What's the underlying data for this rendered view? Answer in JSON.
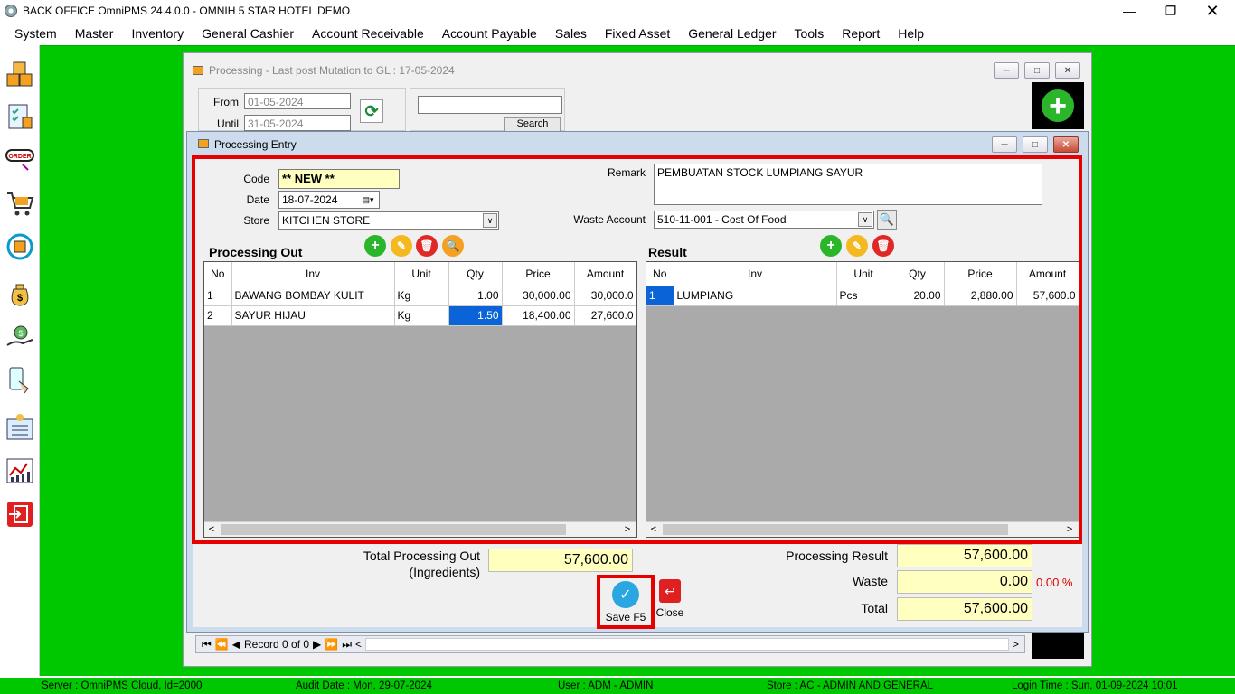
{
  "window": {
    "title": "BACK OFFICE OmniPMS 24.4.0.0 - OMNIH 5 STAR HOTEL DEMO"
  },
  "menu": [
    "System",
    "Master",
    "Inventory",
    "General Cashier",
    "Account Receivable",
    "Account Payable",
    "Sales",
    "Fixed Asset",
    "General Ledger",
    "Tools",
    "Report",
    "Help"
  ],
  "background_window": {
    "title": "Processing - Last post Mutation to GL : 17-05-2024",
    "from_label": "From",
    "from_value": "01-05-2024",
    "until_label": "Until",
    "until_value": "31-05-2024",
    "search_label": "Search",
    "search_value": "",
    "record_text": "Record 0 of 0"
  },
  "dialog": {
    "title": "Processing Entry",
    "code_label": "Code",
    "code_value": "** NEW **",
    "date_label": "Date",
    "date_value": "18-07-2024",
    "store_label": "Store",
    "store_value": "KITCHEN STORE",
    "remark_label": "Remark",
    "remark_value": "PEMBUATAN STOCK LUMPIANG SAYUR",
    "waste_account_label": "Waste Account",
    "waste_account_value": "510-11-001 - Cost Of Food",
    "processing_out": {
      "title": "Processing Out",
      "columns": [
        "No",
        "Inv",
        "Unit",
        "Qty",
        "Price",
        "Amount"
      ],
      "rows": [
        [
          "1",
          "BAWANG BOMBAY KULIT",
          "Kg",
          "1.00",
          "30,000.00",
          "30,000.0"
        ],
        [
          "2",
          "SAYUR HIJAU",
          "Kg",
          "1.50",
          "18,400.00",
          "27,600.0"
        ]
      ]
    },
    "result": {
      "title": "Result",
      "columns": [
        "No",
        "Inv",
        "Unit",
        "Qty",
        "Price",
        "Amount"
      ],
      "rows": [
        [
          "1",
          "LUMPIANG",
          "Pcs",
          "20.00",
          "2,880.00",
          "57,600.0"
        ]
      ]
    },
    "total_out_label_1": "Total Processing Out",
    "total_out_label_2": "(Ingredients)",
    "total_out_value": "57,600.00",
    "processing_result_label": "Processing Result",
    "processing_result_value": "57,600.00",
    "waste_label": "Waste",
    "waste_value": "0.00",
    "waste_percent": "0.00 %",
    "total_label": "Total",
    "total_value": "57,600.00",
    "save_label": "Save F5",
    "close_label": "Close"
  },
  "status": {
    "server": "Server : OmniPMS Cloud, Id=2000",
    "audit_date": "Audit Date : Mon, 29-07-2024",
    "user": "User : ADM - ADMIN",
    "store": "Store : AC - ADMIN AND GENERAL",
    "login_time": "Login Time : Sun, 01-09-2024 10:01"
  },
  "colors": {
    "desktop": "#00c800",
    "highlight": "#e60000",
    "selection": "#0a64d8",
    "input_yellow": "#ffffc0"
  }
}
